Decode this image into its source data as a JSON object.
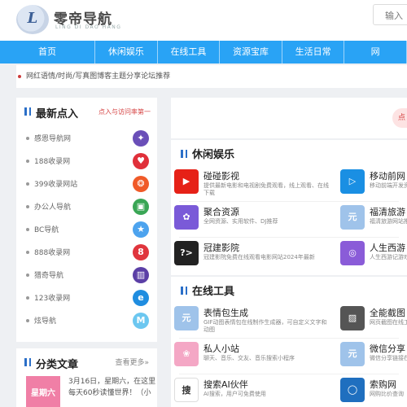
{
  "header": {
    "brand": "零帝导航",
    "brand_sub": "LING DI DAO HANG",
    "search_label": "输入"
  },
  "nav": [
    "首页",
    "休闲娱乐",
    "在线工具",
    "资源宝库",
    "生活日常",
    "网"
  ],
  "notice": "网红语情/时尚/写真图博客主题分享论坛推荐",
  "sidebar": {
    "title": "最新点入",
    "hint": "点入与访问率第一",
    "items": [
      {
        "label": "感恩导航网",
        "color": "#6a4fb8",
        "glyph": "✦"
      },
      {
        "label": "188收录网",
        "color": "#e0303a",
        "glyph": "♥"
      },
      {
        "label": "399收录网站",
        "color": "#f05a28",
        "glyph": "❂"
      },
      {
        "label": "办公人导航",
        "color": "#3aa655",
        "glyph": "▣"
      },
      {
        "label": "BC导航",
        "color": "#4da3ee",
        "glyph": "★"
      },
      {
        "label": "888收录网",
        "color": "#e0353d",
        "glyph": "8"
      },
      {
        "label": "猎奇导航",
        "color": "#5b3fa6",
        "glyph": "▥"
      },
      {
        "label": "123收录网",
        "color": "#1f8de0",
        "glyph": "e"
      },
      {
        "label": "炫导航",
        "color": "#6cc7f0",
        "glyph": "M"
      }
    ],
    "articles_title": "分类文章",
    "more": "查看更多»",
    "article": {
      "thumb": "星期六",
      "text": "3月16日，星期六，在这里每天60秒读懂世界！（小"
    }
  },
  "banner_label": "点",
  "sections": [
    {
      "title": "休闲娱乐",
      "cards": [
        {
          "name": "碰碰影视",
          "desc": "提供最新电影和电视剧免费观看，线上观看、在线下载",
          "color": "#e62117",
          "glyph": "▶"
        },
        {
          "name": "移动前网",
          "desc": "移动前端开发资源分享",
          "color": "#1a8fe3",
          "glyph": "▷"
        },
        {
          "name": "聚合资源",
          "desc": "全网资源、实用软件、DJ推荐",
          "color": "#7a5ad8",
          "glyph": "✿"
        },
        {
          "name": "福清旅游",
          "desc": "福清旅游网站推荐",
          "color": "#9fc3ea",
          "glyph": "元"
        },
        {
          "name": "冠建影院",
          "desc": "冠建影院免费在线观看电影网站2024年最新",
          "color": "#222222",
          "glyph": "?>"
        },
        {
          "name": "人生西游",
          "desc": "人生西游记游戏推荐",
          "color": "#8a5cd8",
          "glyph": "◎"
        }
      ]
    },
    {
      "title": "在线工具",
      "cards": [
        {
          "name": "表情包生成",
          "desc": "GIF动图表情包在线制作生成器，可自定义文字和动图",
          "color": "#9fc3ea",
          "glyph": "元"
        },
        {
          "name": "全能截图",
          "desc": "网页截图在线工具",
          "color": "#555555",
          "glyph": "▨"
        },
        {
          "name": "私人小站",
          "desc": "聊天、音乐、交友、音乐搜索小程序",
          "color": "#f4a7c5",
          "glyph": "❀"
        },
        {
          "name": "微信分享",
          "desc": "微信分享链接在线生成",
          "color": "#9fc3ea",
          "glyph": "元"
        },
        {
          "name": "搜索AI伙伴",
          "desc": "AI搜索，用户可免费使用",
          "color": "#ffffff",
          "glyph": "搜"
        },
        {
          "name": "索购网",
          "desc": "网购比价查询",
          "color": "#1f6fbf",
          "glyph": "◯"
        }
      ]
    }
  ]
}
